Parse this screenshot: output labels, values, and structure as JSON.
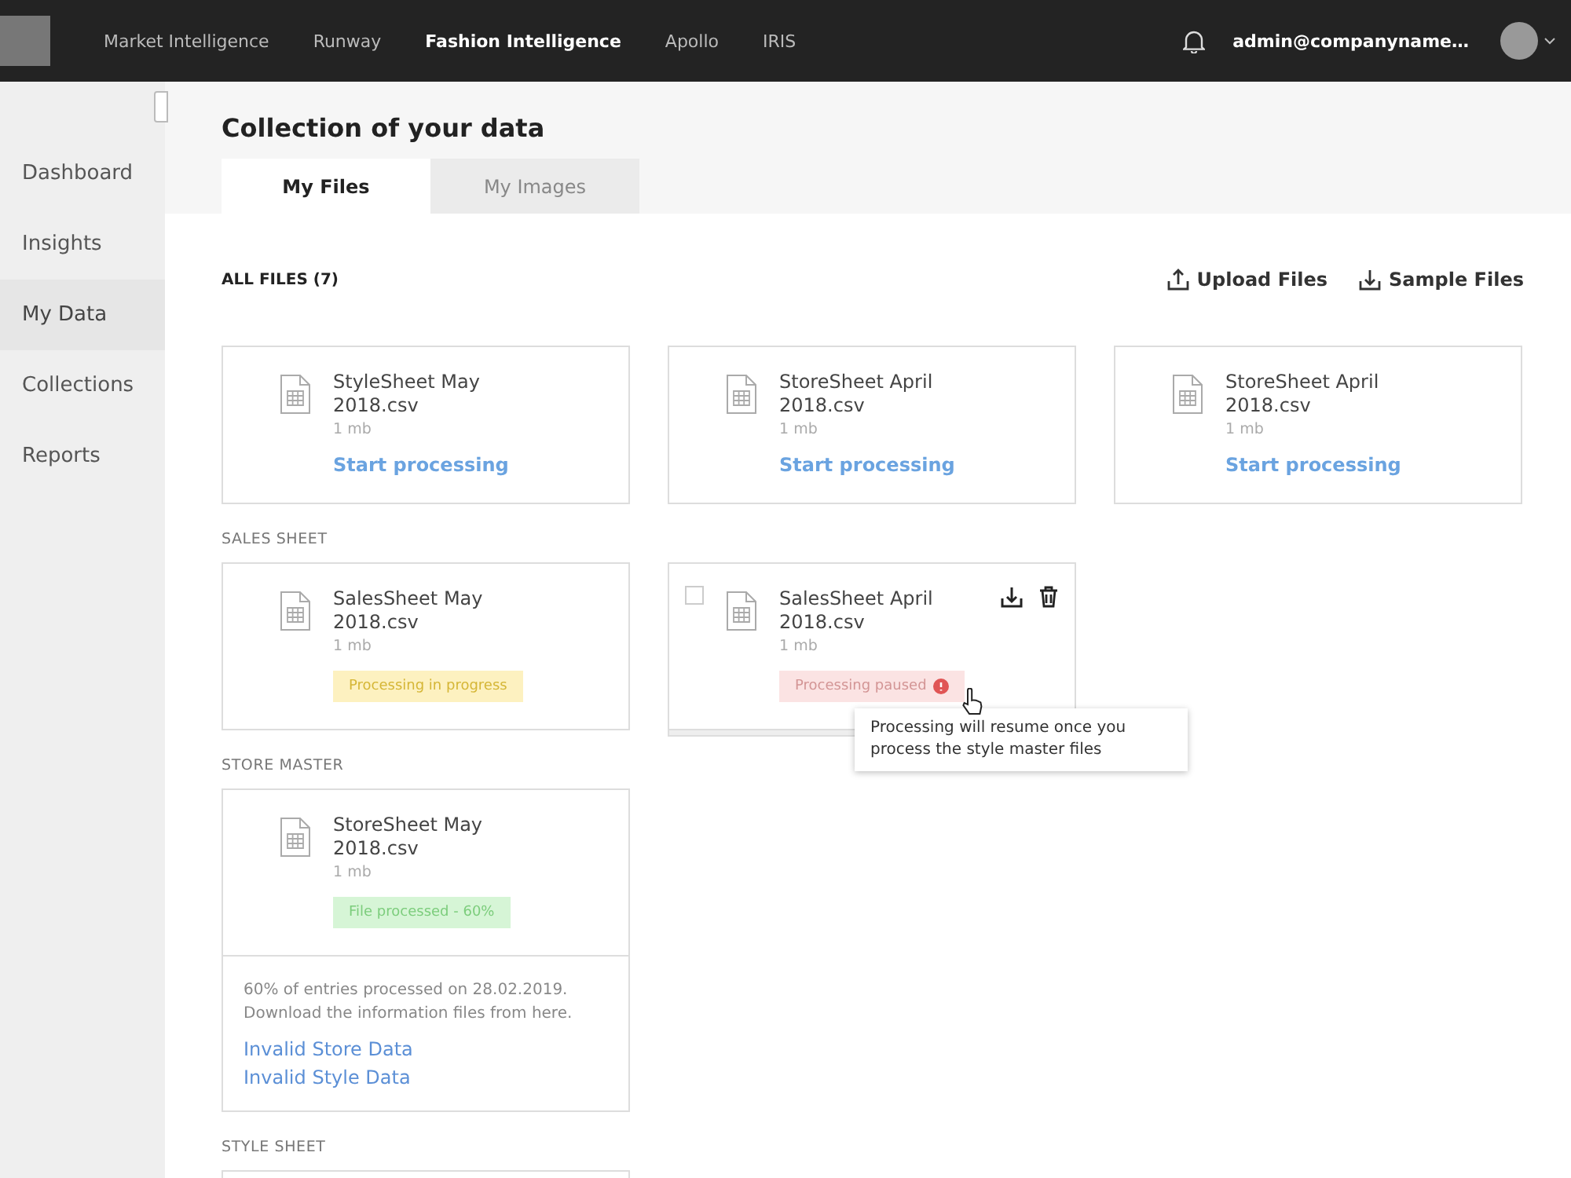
{
  "topbar": {
    "nav": [
      {
        "label": "Market Intelligence",
        "selected": false
      },
      {
        "label": "Runway",
        "selected": false
      },
      {
        "label": "Fashion Intelligence",
        "selected": true
      },
      {
        "label": "Apollo",
        "selected": false
      },
      {
        "label": "IRIS",
        "selected": false
      }
    ],
    "user": "admin@companyname…"
  },
  "sidebar": {
    "items": [
      {
        "label": "Dashboard",
        "selected": false
      },
      {
        "label": "Insights",
        "selected": false
      },
      {
        "label": "My Data",
        "selected": true
      },
      {
        "label": "Collections",
        "selected": false
      },
      {
        "label": "Reports",
        "selected": false
      }
    ]
  },
  "page_title": "Collection of your data",
  "tabs": [
    {
      "label": "My Files",
      "selected": true
    },
    {
      "label": "My Images",
      "selected": false
    }
  ],
  "files_heading": "ALL FILES (7)",
  "actions": [
    {
      "kind": "upload",
      "label": "Upload Files"
    },
    {
      "kind": "download",
      "label": "Sample Files"
    }
  ],
  "sections": [
    {
      "files": [
        {
          "name": "StyleSheet May 2018.csv",
          "size": "1 mb",
          "kind": "start",
          "action": "Start processing"
        },
        {
          "name": "StoreSheet April 2018.csv",
          "size": "1 mb",
          "kind": "start",
          "action": "Start processing"
        },
        {
          "name": "StoreSheet April 2018.csv",
          "size": "1 mb",
          "kind": "start",
          "action": "Start processing"
        }
      ]
    },
    {
      "heading": "SALES SHEET",
      "files": [
        {
          "name": "SalesSheet May 2018.csv",
          "size": "1 mb",
          "kind": "status",
          "status": "Processing in progress",
          "color": "#fdf1c0"
        },
        {
          "name": "SalesSheet April 2018.csv",
          "size": "1 mb",
          "kind": "status",
          "status": "Processing paused",
          "color": "#fbe3e3",
          "alert": true,
          "checked": false,
          "hovered": true,
          "tooltip": "Processing will resume once you process the style master files"
        }
      ]
    },
    {
      "heading": "STORE MASTER",
      "files": [
        {
          "name": "StoreSheet May 2018.csv",
          "size": "1 mb",
          "kind": "status",
          "status": "File processed - 60%",
          "color": "#d6f5d6",
          "details": "60% of entries processed on 28.02.2019. Download the information files from here.",
          "links": [
            "Invalid Store Data",
            "Invalid Style Data"
          ]
        }
      ]
    },
    {
      "heading": "STYLE SHEET",
      "files": [
        {
          "kind": "cut"
        }
      ]
    }
  ]
}
